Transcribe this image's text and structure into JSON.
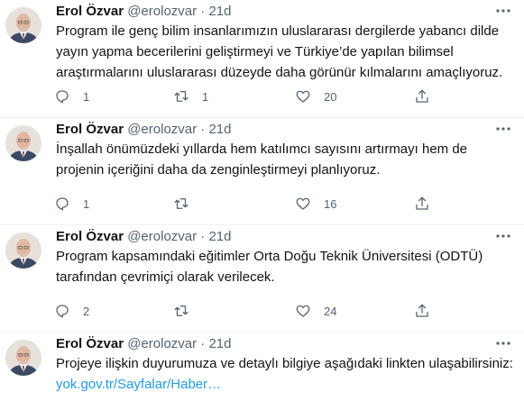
{
  "tweets": [
    {
      "name": "Erol Özvar",
      "handle": "@erolozvar",
      "dot": "·",
      "time": "21d",
      "text": "Program ile genç bilim insanlarımızın uluslararası dergilerde yabancı dilde yayın yapma becerilerini geliştirmeyi ve Türkiye’de yapılan bilimsel araştırmalarını uluslararası düzeyde daha görünür kılmalarını amaçlıyoruz.",
      "replies": "1",
      "retweets": "1",
      "likes": "20"
    },
    {
      "name": "Erol Özvar",
      "handle": "@erolozvar",
      "dot": "·",
      "time": "21d",
      "text": "İnşallah önümüzdeki yıllarda hem katılımcı sayısını artırmayı hem de projenin içeriğini daha da zenginleştirmeyi planlıyoruz.",
      "replies": "1",
      "retweets": "",
      "likes": "16"
    },
    {
      "name": "Erol Özvar",
      "handle": "@erolozvar",
      "dot": "·",
      "time": "21d",
      "text": "Program kapsamındaki eğitimler Orta Doğu Teknik Üniversitesi (ODTÜ) tarafından çevrimiçi olarak verilecek.",
      "replies": "2",
      "retweets": "",
      "likes": "24"
    },
    {
      "name": "Erol Özvar",
      "handle": "@erolozvar",
      "dot": "·",
      "time": "21d",
      "text": "Projeye ilişkin duyurumuza ve detaylı bilgiye aşağıdaki linkten ulaşabilirsiniz:",
      "link": "yok.gov.tr/Sayfalar/Haber…"
    }
  ],
  "icons": {
    "more": "more-horizontal-icon",
    "reply": "reply-icon",
    "retweet": "retweet-icon",
    "like": "heart-icon",
    "share": "share-icon"
  },
  "colors": {
    "link": "#1d9bf0",
    "secondary_text": "#536471",
    "primary_text": "#0f1419",
    "divider": "#eff3f4"
  }
}
